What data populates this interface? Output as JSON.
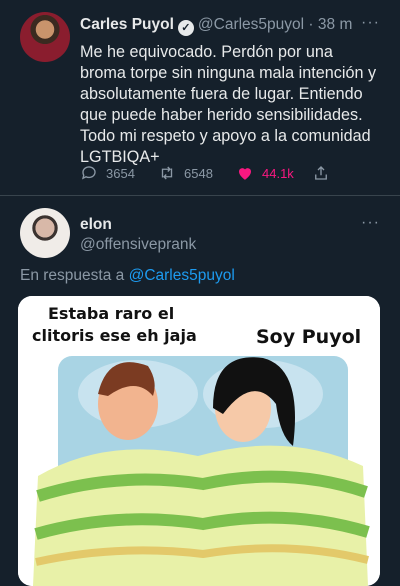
{
  "tweet1": {
    "name": "Carles Puyol",
    "handle": "@Carles5puyol",
    "separator": "·",
    "time": "38 m",
    "text": "Me he equivocado. Perdón por una broma torpe sin ninguna mala intención y absolutamente fuera de lugar. Entiendo que puede haber herido sensibilidades. Todo mi respeto y apoyo a la comunidad LGTBIQA+",
    "replies": "3654",
    "retweets": "6548",
    "likes": "44.1k",
    "more": "···"
  },
  "tweet2": {
    "name": "elon",
    "handle": "@offensiveprank",
    "more": "···",
    "reply_prefix": "En respuesta a",
    "reply_handle": "@Carles5puyol",
    "meme": {
      "caption_left_1": "Estaba raro el",
      "caption_left_2": "clitoris ese eh jaja",
      "caption_right": "Soy Puyol"
    }
  },
  "colors": {
    "background": "#15202b",
    "text": "#e7e9ea",
    "muted": "#8b98a5",
    "link": "#1d9bf0",
    "like": "#f91880"
  }
}
